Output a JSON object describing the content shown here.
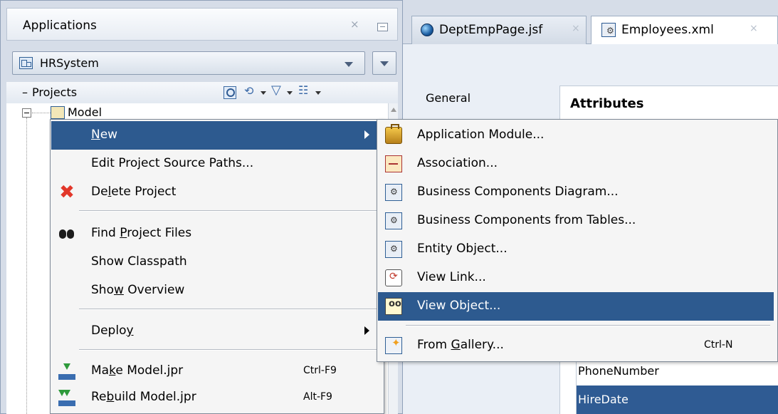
{
  "applications_panel": {
    "title": "Applications",
    "close_glyph": "×",
    "app_selector": {
      "value": "HRSystem"
    },
    "projects_section": {
      "label": "Projects",
      "collapse_glyph": "–"
    },
    "tree": {
      "root_project": "Model"
    }
  },
  "editor": {
    "tabs": [
      {
        "label": "DeptEmpPage.jsf",
        "icon": "jsf-page-icon"
      },
      {
        "label": "Employees.xml",
        "icon": "entity-object-icon"
      }
    ],
    "tab_close_glyph": "×",
    "nav_general": "General",
    "section_title": "Attributes",
    "attributes": [
      "PhoneNumber",
      "HireDate"
    ]
  },
  "context_menu": {
    "items": [
      {
        "label": "New",
        "mnemonic": "N",
        "has_submenu": true
      },
      {
        "label": "Edit Project Source Paths..."
      },
      {
        "label": "Delete Project",
        "icon": "delete-icon"
      },
      {
        "label": "Find Project Files",
        "icon": "binoculars-icon"
      },
      {
        "label": "Show Classpath"
      },
      {
        "label": "Show Overview"
      },
      {
        "label": "Deploy",
        "has_submenu": true
      },
      {
        "label": "Make Model.jpr",
        "shortcut": "Ctrl-F9",
        "icon": "make-icon"
      },
      {
        "label": "Rebuild Model.jpr",
        "shortcut": "Alt-F9",
        "icon": "rebuild-icon"
      }
    ]
  },
  "submenu": {
    "items": [
      {
        "label": "Application Module...",
        "icon": "application-module-icon"
      },
      {
        "label": "Association...",
        "icon": "association-icon"
      },
      {
        "label": "Business Components Diagram...",
        "icon": "bc-diagram-icon"
      },
      {
        "label": "Business Components from Tables...",
        "icon": "bc-tables-icon"
      },
      {
        "label": "Entity Object...",
        "icon": "entity-object-icon"
      },
      {
        "label": "View Link...",
        "icon": "view-link-icon"
      },
      {
        "label": "View Object...",
        "icon": "view-object-icon"
      },
      {
        "label": "From Gallery...",
        "shortcut": "Ctrl-N",
        "icon": "gallery-icon"
      }
    ]
  },
  "colors": {
    "selection": "#2d5a8f",
    "panel_bg": "#d6dde8",
    "menu_bg": "#f5f5f5"
  }
}
